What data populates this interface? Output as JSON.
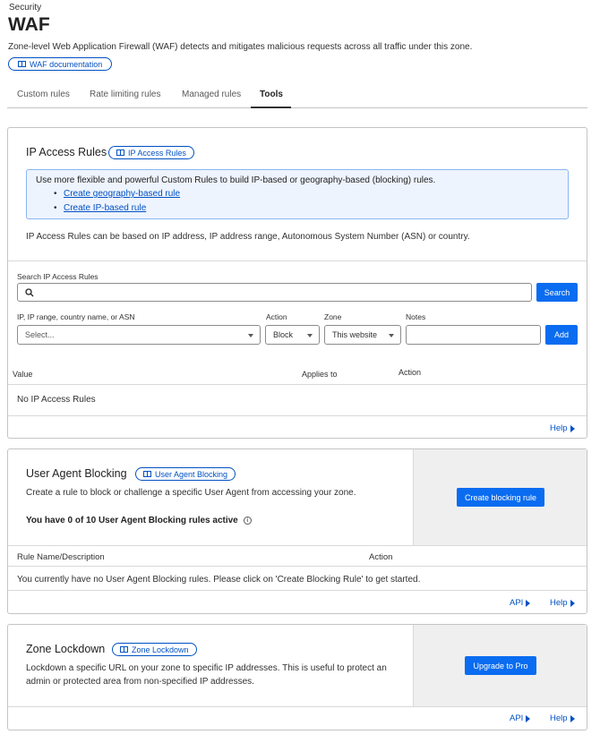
{
  "header": {
    "section": "Security",
    "title": "WAF",
    "description": "Zone-level Web Application Firewall (WAF) detects and mitigates malicious requests across all traffic under this zone.",
    "doc_link": "WAF documentation"
  },
  "tabs": [
    {
      "label": "Custom rules"
    },
    {
      "label": "Rate limiting rules"
    },
    {
      "label": "Managed rules"
    },
    {
      "label": "Tools",
      "active": true
    }
  ],
  "ip_access": {
    "title": "IP Access Rules",
    "pill": "IP Access Rules",
    "notice": "Use more flexible and powerful Custom Rules to build IP-based or geography-based (blocking) rules.",
    "notice_links": [
      "Create geography-based rule",
      "Create IP-based rule"
    ],
    "info": "IP Access Rules can be based on IP address, IP address range, Autonomous System Number (ASN) or country.",
    "search_label": "Search IP Access Rules",
    "search_placeholder": "",
    "search_button": "Search",
    "value_label": "IP, IP range, country name, or ASN",
    "value_placeholder": "Select...",
    "action_label": "Action",
    "action_value": "Block",
    "zone_label": "Zone",
    "zone_value": "This website",
    "notes_label": "Notes",
    "add_button": "Add",
    "table_headers": [
      "Value",
      "Applies to",
      "Action"
    ],
    "empty": "No IP Access Rules",
    "help": "Help"
  },
  "ua_blocking": {
    "title": "User Agent Blocking",
    "pill": "User Agent Blocking",
    "description": "Create a rule to block or challenge a specific User Agent from accessing your zone.",
    "count_text": "You have 0 of 10 User Agent Blocking rules active",
    "create_button": "Create blocking rule",
    "table_headers": [
      "Rule Name/Description",
      "Action"
    ],
    "empty": "You currently have no User Agent Blocking rules. Please click on 'Create Blocking Rule' to get started.",
    "api": "API",
    "help": "Help"
  },
  "zone_lockdown": {
    "title": "Zone Lockdown",
    "pill": "Zone Lockdown",
    "description_line1": "Lockdown a specific URL on your zone to specific IP addresses. This is useful to protect an",
    "description_line2": "admin or protected area from non-specified IP addresses.",
    "upgrade_button": "Upgrade to Pro",
    "api": "API",
    "help": "Help"
  },
  "colors": {
    "accent": "#0a6cf0",
    "link": "#0051c3",
    "notice_bg": "#eef4fe",
    "panel_bg": "#efefef"
  }
}
